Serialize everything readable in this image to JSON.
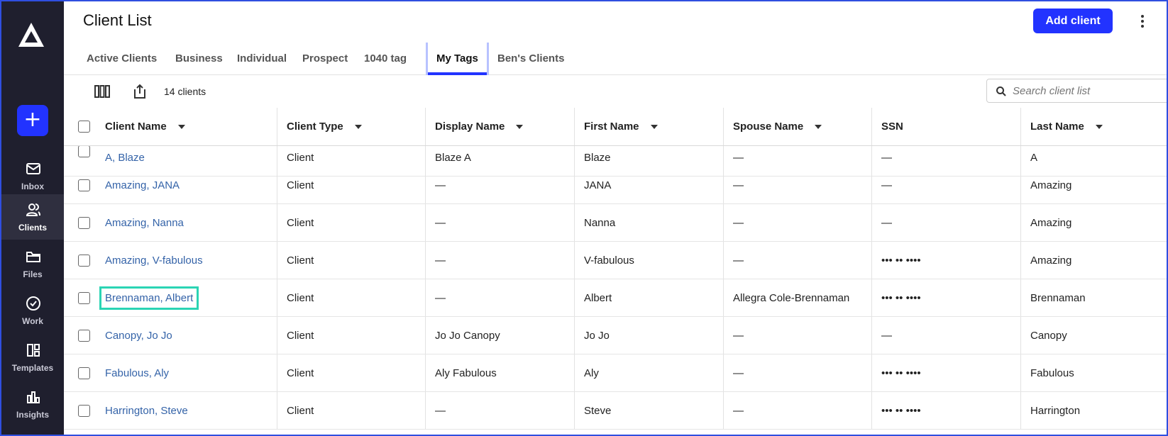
{
  "sidebar": {
    "new_label": "+",
    "items": [
      {
        "label": "Inbox",
        "icon": "mail-icon"
      },
      {
        "label": "Clients",
        "icon": "users-icon",
        "active": true
      },
      {
        "label": "Files",
        "icon": "folder-icon"
      },
      {
        "label": "Work",
        "icon": "check-circle-icon"
      },
      {
        "label": "Templates",
        "icon": "templates-icon"
      },
      {
        "label": "Insights",
        "icon": "bar-chart-icon"
      }
    ]
  },
  "header": {
    "title": "Client List",
    "add_label": "Add client"
  },
  "tabs": [
    "Active Clients",
    "Business",
    "Individual",
    "Prospect",
    "1040 tag",
    "My Tags",
    "Ben's Clients"
  ],
  "active_tab": "My Tags",
  "toolbar": {
    "count": "14 clients",
    "search_placeholder": "Search client list"
  },
  "table": {
    "columns": [
      "Client Name",
      "Client Type",
      "Display Name",
      "First Name",
      "Spouse Name",
      "SSN",
      "Last Name"
    ],
    "rows": [
      [
        "A, Blaze",
        "Client",
        "Blaze A",
        "Blaze",
        "—",
        "—",
        "A"
      ],
      [
        "Amazing, JANA",
        "Client",
        "—",
        "JANA",
        "—",
        "—",
        "Amazing"
      ],
      [
        "Amazing, Nanna",
        "Client",
        "—",
        "Nanna",
        "—",
        "—",
        "Amazing"
      ],
      [
        "Amazing, V-fabulous",
        "Client",
        "—",
        "V-fabulous",
        "—",
        "••• •• ••••",
        "Amazing"
      ],
      [
        "Brennaman, Albert",
        "Client",
        "—",
        "Albert",
        "Allegra Cole-Brennaman",
        "••• •• ••••",
        "Brennaman"
      ],
      [
        "Canopy, Jo Jo",
        "Client",
        "Jo Jo Canopy",
        "Jo Jo",
        "—",
        "—",
        "Canopy"
      ],
      [
        "Fabulous, Aly",
        "Client",
        "Aly Fabulous",
        "Aly",
        "—",
        "••• •• ••••",
        "Fabulous"
      ],
      [
        "Harrington, Steve",
        "Client",
        "—",
        "Steve",
        "—",
        "••• •• ••••",
        "Harrington"
      ]
    ]
  },
  "colors": {
    "accent": "#2233ff",
    "sidebar_bg": "#1f1f2e",
    "link": "#3463a8",
    "highlight": "#2bd4b4"
  }
}
